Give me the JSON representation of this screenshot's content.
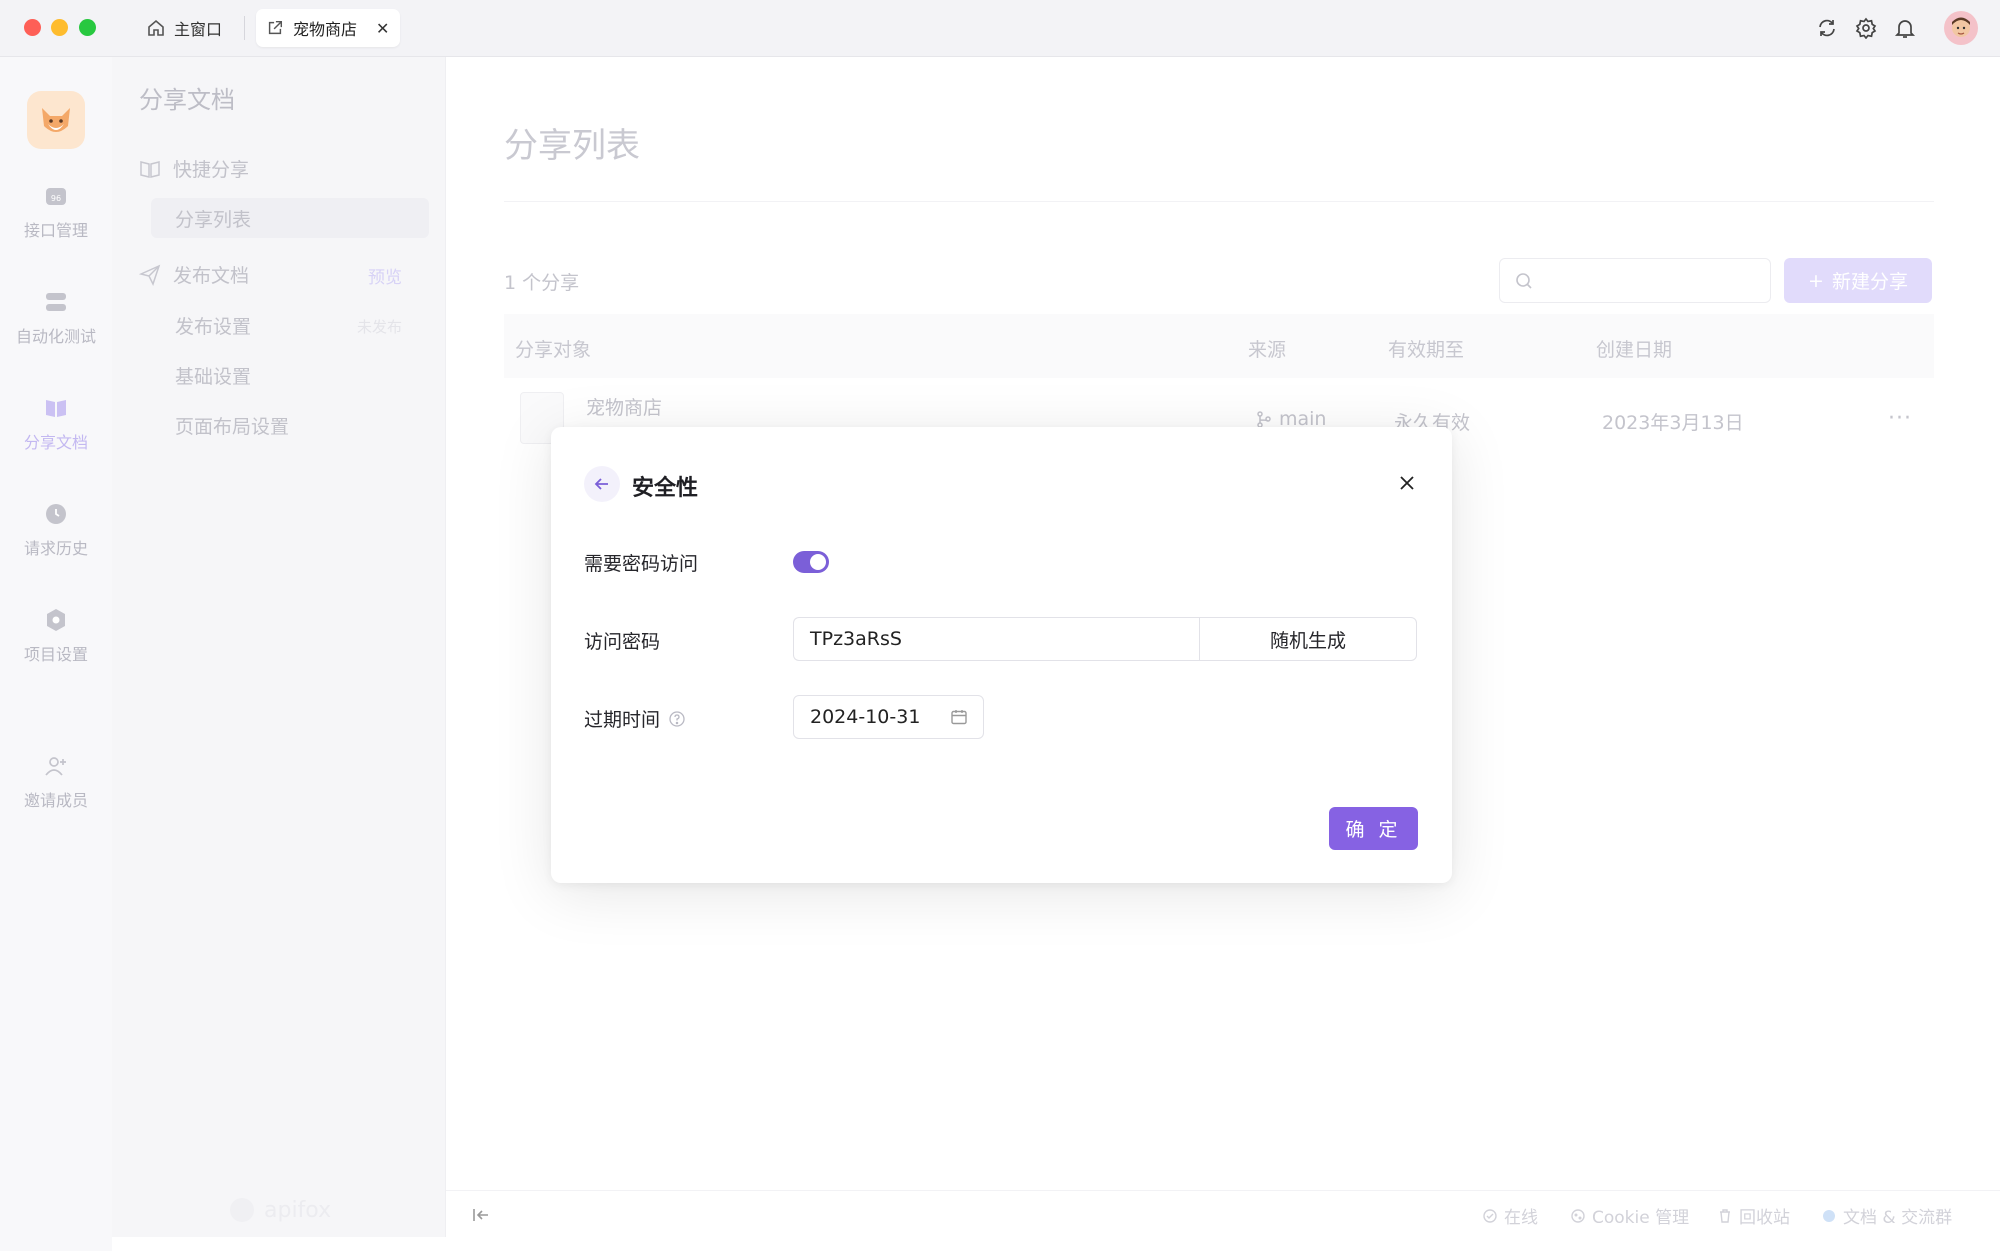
{
  "titlebar": {
    "home_tab": "主窗口",
    "active_tab": "宠物商店",
    "tab_close": "✕"
  },
  "rail": {
    "items": [
      {
        "label": "接口管理",
        "icon": "api-icon"
      },
      {
        "label": "自动化测试",
        "icon": "automation-icon"
      },
      {
        "label": "分享文档",
        "icon": "share-doc-icon"
      },
      {
        "label": "请求历史",
        "icon": "history-icon"
      },
      {
        "label": "项目设置",
        "icon": "settings-icon"
      },
      {
        "label": "邀请成员",
        "icon": "invite-icon"
      }
    ]
  },
  "sidebar": {
    "title": "分享文档",
    "quick_share": "快捷分享",
    "share_list": "分享列表",
    "publish_docs": "发布文档",
    "preview": "预览",
    "publish_settings": "发布设置",
    "unpublished": "未发布",
    "basic_settings": "基础设置",
    "layout_settings": "页面布局设置",
    "footer_brand": "apifox"
  },
  "main": {
    "title": "分享列表",
    "count": "1 个分享",
    "new_share": "新建分享",
    "columns": [
      "分享对象",
      "来源",
      "有效期至",
      "创建日期"
    ],
    "row": {
      "name": "宠物商店",
      "source": "main",
      "valid_until": "永久有效",
      "created": "2023年3月13日",
      "more": "···"
    }
  },
  "bottombar": {
    "online": "在线",
    "cookie": "Cookie 管理",
    "trash": "回收站",
    "docs": "文档 & 交流群"
  },
  "modal": {
    "title": "安全性",
    "require_password_label": "需要密码访问",
    "require_password_on": true,
    "access_password_label": "访问密码",
    "access_password_value": "TPz3aRsS",
    "random_button": "随机生成",
    "expire_label": "过期时间",
    "expire_value": "2024-10-31",
    "confirm": "确 定"
  },
  "colors": {
    "accent": "#8662e3",
    "toggle": "#7b5fd8"
  }
}
